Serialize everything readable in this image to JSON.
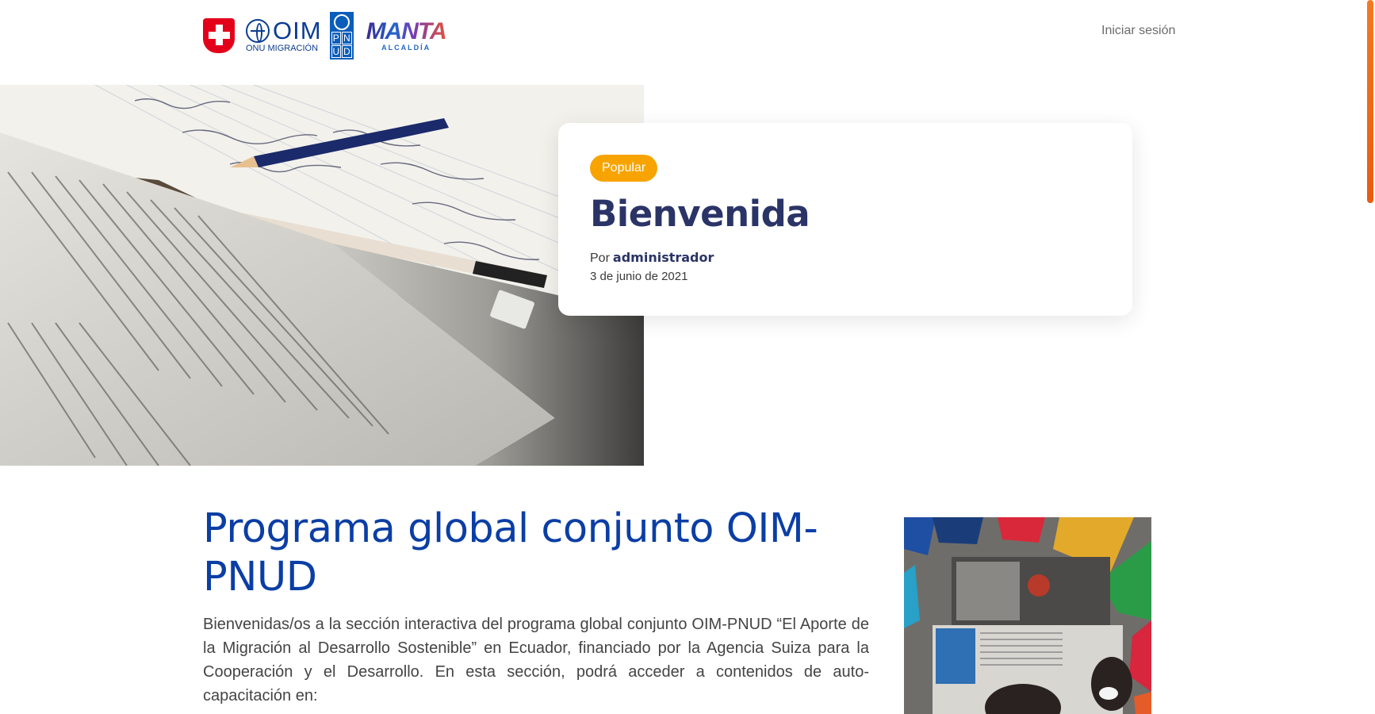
{
  "header": {
    "logos": {
      "oim_text": "OIM",
      "oim_sub": "ONU MIGRACIÓN",
      "pnud_letters": [
        "P",
        "N",
        "U",
        "D"
      ],
      "manta_text": "MANTA",
      "manta_sub": "ALCALDÍA"
    },
    "login_label": "Iniciar sesión"
  },
  "hero": {
    "badge": "Popular",
    "title": "Bienvenida",
    "byline_prefix": "Por",
    "author": "administrador",
    "date": "3 de junio de 2021"
  },
  "content": {
    "title": "Programa global conjunto OIM-PNUD",
    "body": "Bienvenidas/os a la sección interactiva del programa global conjunto OIM-PNUD “El Aporte de la Migración al Desarrollo Sostenible” en Ecuador, financiado por la Agencia Suiza para la Cooperación y el Desarrollo. En esta sección, podrá acceder a contenidos de auto-capacitación en:"
  },
  "colors": {
    "accent_orange": "#f7a400",
    "title_navy": "#2b3467",
    "section_blue": "#0b3ea5",
    "swiss_red": "#e3001b",
    "scrollbar_orange": "#f37a20"
  },
  "icons": {
    "swiss_flag": "swiss-flag-icon",
    "oim_globe": "un-globe-icon",
    "pnud_globe": "un-globe-icon"
  }
}
